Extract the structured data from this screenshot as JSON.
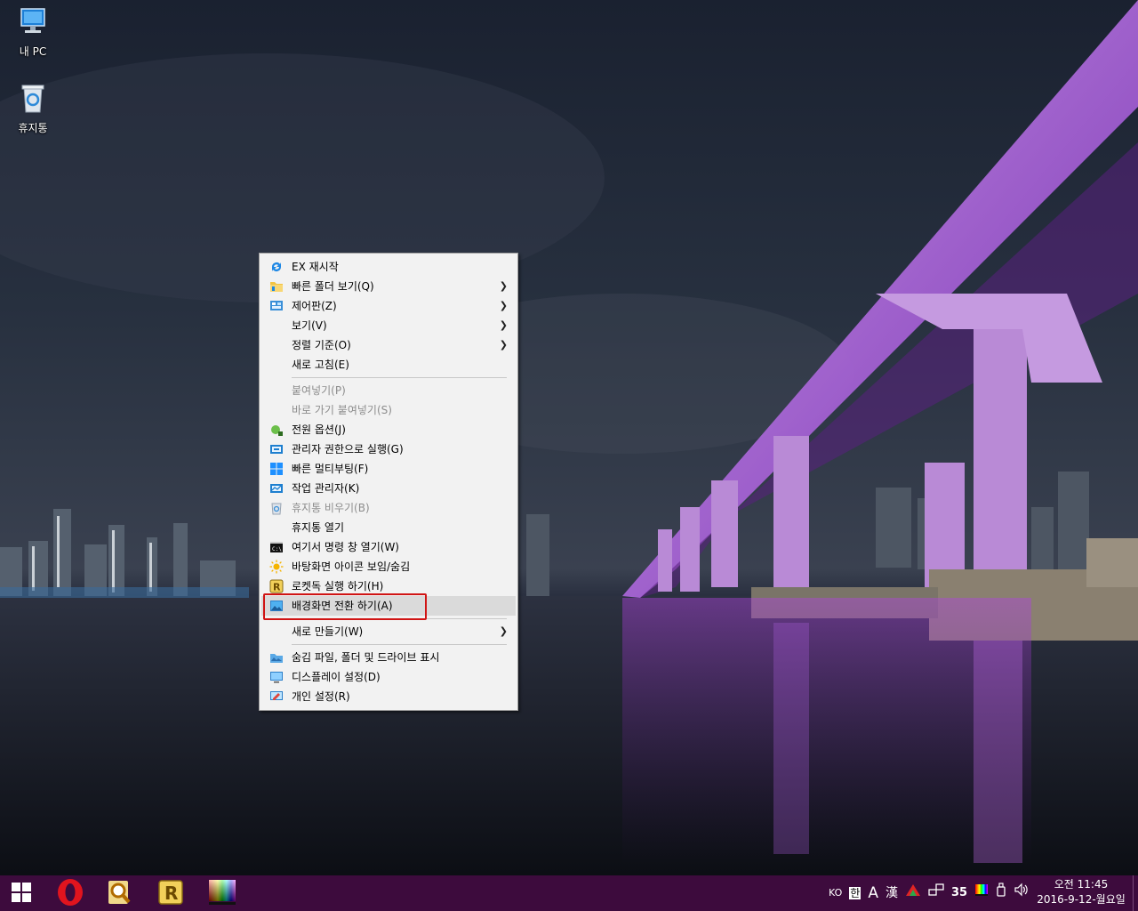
{
  "desktop": {
    "icons": [
      {
        "label": "내 PC",
        "icon": "computer-icon"
      },
      {
        "label": "휴지통",
        "icon": "recycle-bin-icon"
      }
    ]
  },
  "context_menu": {
    "items": [
      {
        "label": "EX 재시작",
        "icon": "refresh-icon",
        "enabled": true,
        "submenu": false
      },
      {
        "label": "빠른 폴더 보기(Q)",
        "icon": "folder-icon",
        "enabled": true,
        "submenu": true
      },
      {
        "label": "제어판(Z)",
        "icon": "control-panel-icon",
        "enabled": true,
        "submenu": true
      },
      {
        "label": "보기(V)",
        "icon": "",
        "enabled": true,
        "submenu": true
      },
      {
        "label": "정렬 기준(O)",
        "icon": "",
        "enabled": true,
        "submenu": true
      },
      {
        "label": "새로 고침(E)",
        "icon": "",
        "enabled": true,
        "submenu": false
      },
      {
        "label": "붙여넣기(P)",
        "icon": "",
        "enabled": false,
        "submenu": false
      },
      {
        "label": "바로 가기 붙여넣기(S)",
        "icon": "",
        "enabled": false,
        "submenu": false
      },
      {
        "label": "전원 옵션(J)",
        "icon": "power-options-icon",
        "enabled": true,
        "submenu": false
      },
      {
        "label": "관리자 권한으로 실행(G)",
        "icon": "run-admin-icon",
        "enabled": true,
        "submenu": false
      },
      {
        "label": "빠른 멀티부팅(F)",
        "icon": "windows-logo-icon",
        "enabled": true,
        "submenu": false
      },
      {
        "label": "작업 관리자(K)",
        "icon": "task-manager-icon",
        "enabled": true,
        "submenu": false
      },
      {
        "label": "휴지통 비우기(B)",
        "icon": "recycle-bin-icon",
        "enabled": false,
        "submenu": false
      },
      {
        "label": "휴지통 열기",
        "icon": "",
        "enabled": true,
        "submenu": false
      },
      {
        "label": "여기서 명령 창 열기(W)",
        "icon": "command-prompt-icon",
        "enabled": true,
        "submenu": false
      },
      {
        "label": "바탕화면 아이콘 보임/숨김",
        "icon": "sun-icon",
        "enabled": true,
        "submenu": false
      },
      {
        "label": "로켓독 실행  하기(H)",
        "icon": "rocketdock-icon",
        "enabled": true,
        "submenu": false
      },
      {
        "label": "배경화면 전환 하기(A)",
        "icon": "wallpaper-icon",
        "enabled": true,
        "submenu": false,
        "selected": true
      },
      {
        "label": "새로 만들기(W)",
        "icon": "",
        "enabled": true,
        "submenu": true
      },
      {
        "label": "숨김 파일, 폴더 및 드라이브 표시",
        "icon": "hidden-files-icon",
        "enabled": true,
        "submenu": false
      },
      {
        "label": "디스플레이 설정(D)",
        "icon": "display-icon",
        "enabled": true,
        "submenu": false
      },
      {
        "label": "개인 설정(R)",
        "icon": "personalize-icon",
        "enabled": true,
        "submenu": false
      }
    ]
  },
  "taskbar": {
    "pinned": [
      {
        "name": "start-button",
        "icon": "windows-logo-icon"
      },
      {
        "name": "opera-button",
        "icon": "opera-icon"
      },
      {
        "name": "search-tool-button",
        "icon": "magnifier-icon"
      },
      {
        "name": "rocketdock-button",
        "icon": "rocketdock-icon"
      },
      {
        "name": "color-app-button",
        "icon": "color-palette-icon"
      }
    ],
    "tray": {
      "lang": "KO",
      "ime_hangul": "한",
      "ime_mode": "A",
      "ime_hanja": "漢",
      "badge_number": "35"
    },
    "clock": {
      "time": "오전 11:45",
      "date": "2016-9-12-월요일"
    }
  },
  "colors": {
    "taskbar": "#3d0b3d",
    "menu_bg": "#f2f2f2",
    "highlight": "#d01414"
  }
}
